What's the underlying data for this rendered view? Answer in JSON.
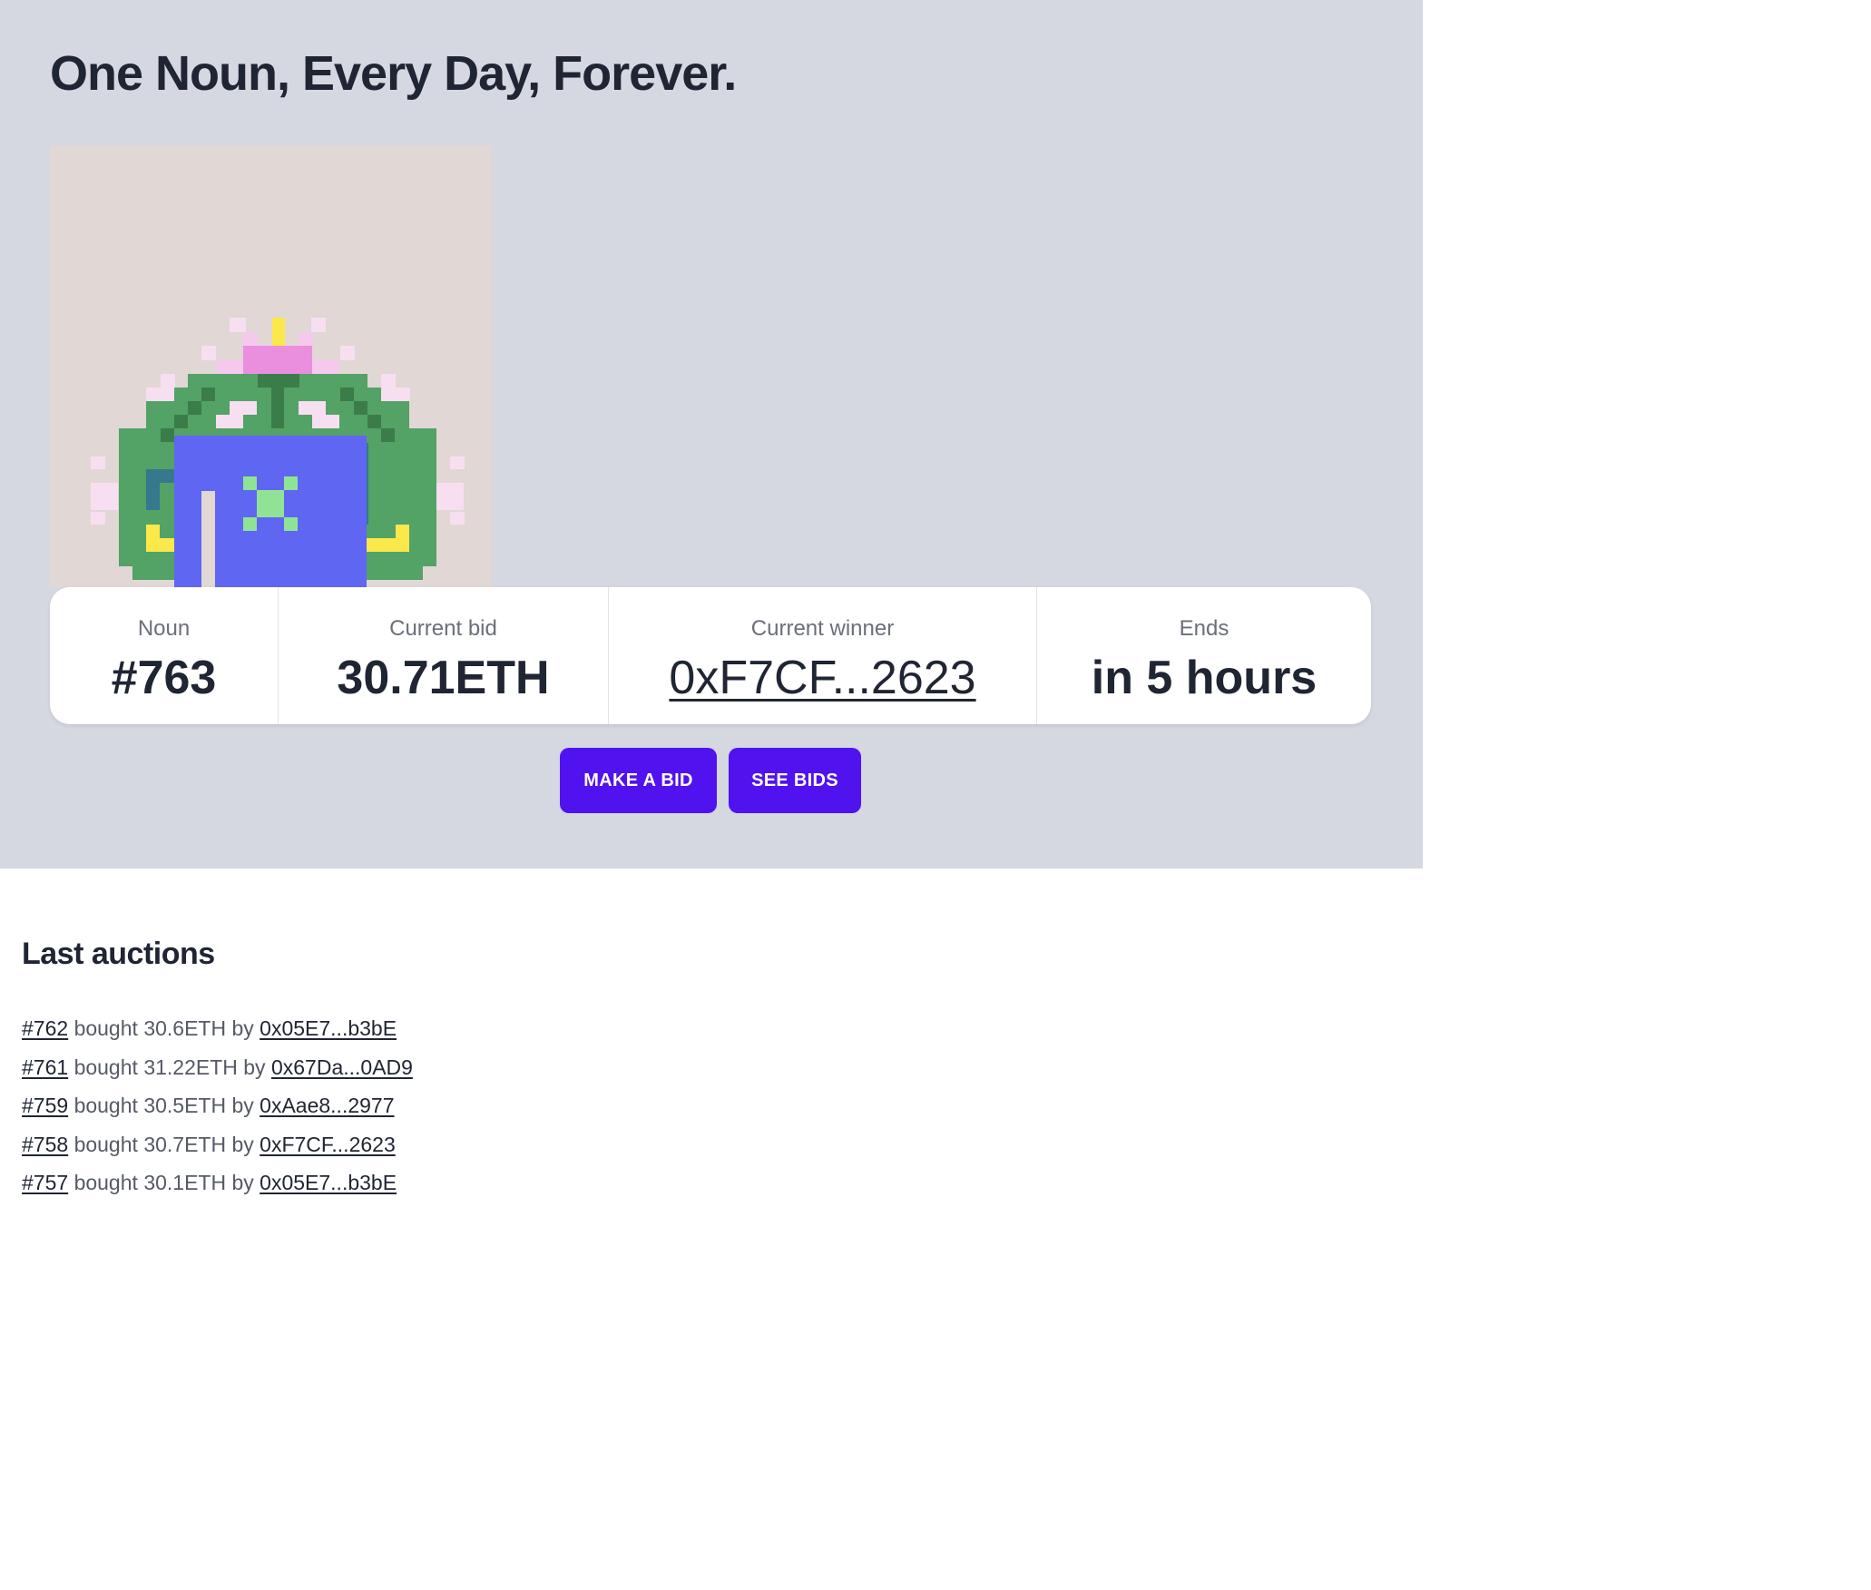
{
  "title": "One Noun, Every Day, Forever.",
  "noun_image": {
    "background": "#e1d7d5",
    "alt": "Noun 763"
  },
  "stats": {
    "noun": {
      "label": "Noun",
      "value": "#763"
    },
    "current_bid": {
      "label": "Current bid",
      "value": "30.71ETH"
    },
    "current_winner": {
      "label": "Current winner",
      "value": "0xF7CF...2623"
    },
    "ends": {
      "label": "Ends",
      "value": "in 5 hours"
    }
  },
  "buttons": {
    "make_bid": "MAKE A BID",
    "see_bids": "SEE BIDS"
  },
  "last_auctions": {
    "heading": "Last auctions",
    "word_bought": "bought",
    "word_by": "by",
    "items": [
      {
        "id": "#762",
        "amount": "30.6ETH",
        "buyer": "0x05E7...b3bE"
      },
      {
        "id": "#761",
        "amount": "31.22ETH",
        "buyer": "0x67Da...0AD9"
      },
      {
        "id": "#759",
        "amount": "30.5ETH",
        "buyer": "0xAae8...2977"
      },
      {
        "id": "#758",
        "amount": "30.7ETH",
        "buyer": "0xF7CF...2623"
      },
      {
        "id": "#757",
        "amount": "30.1ETH",
        "buyer": "0x05E7...b3bE"
      }
    ]
  },
  "colors": {
    "hero_bg": "#d5d7e1",
    "button_bg": "#5012ef",
    "text": "#1f2533"
  }
}
